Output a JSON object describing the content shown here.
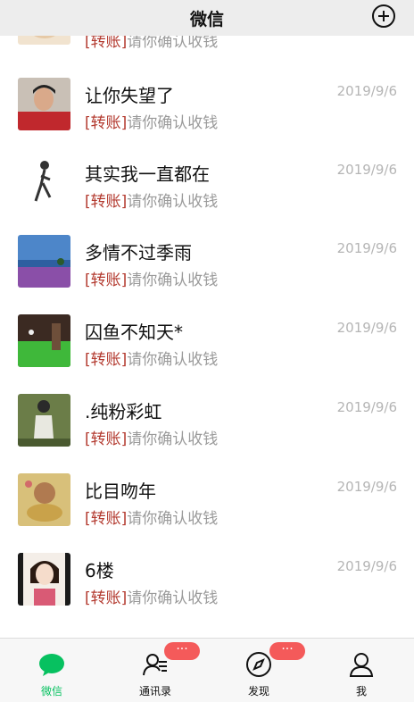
{
  "header": {
    "title": "微信",
    "add_icon": "plus-circle-icon"
  },
  "chats": [
    {
      "name": "",
      "tag": "[转账]",
      "preview": "请你确认收钱",
      "date": ""
    },
    {
      "name": "让你失望了",
      "tag": "[转账]",
      "preview": "请你确认收钱",
      "date": "2019/9/6"
    },
    {
      "name": "其实我一直都在",
      "tag": "[转账]",
      "preview": "请你确认收钱",
      "date": "2019/9/6"
    },
    {
      "name": "多情不过季雨",
      "tag": "[转账]",
      "preview": "请你确认收钱",
      "date": "2019/9/6"
    },
    {
      "name": "囚鱼不知天*",
      "tag": "[转账]",
      "preview": "请你确认收钱",
      "date": "2019/9/6"
    },
    {
      "name": ".纯粉彩虹",
      "tag": "[转账]",
      "preview": "请你确认收钱",
      "date": "2019/9/6"
    },
    {
      "name": "比目吻年",
      "tag": "[转账]",
      "preview": "请你确认收钱",
      "date": "2019/9/6"
    },
    {
      "name": "6楼",
      "tag": "[转账]",
      "preview": "请你确认收钱",
      "date": "2019/9/6"
    }
  ],
  "tabs": [
    {
      "label": "微信",
      "icon": "chat-bubble-icon",
      "active": true
    },
    {
      "label": "通讯录",
      "icon": "contacts-icon",
      "badge": "···"
    },
    {
      "label": "发现",
      "icon": "compass-icon",
      "badge": "···"
    },
    {
      "label": "我",
      "icon": "person-icon"
    }
  ],
  "colors": {
    "accent": "#07c160",
    "transfer_tag": "#b33a2f",
    "badge": "#f45a5a"
  }
}
